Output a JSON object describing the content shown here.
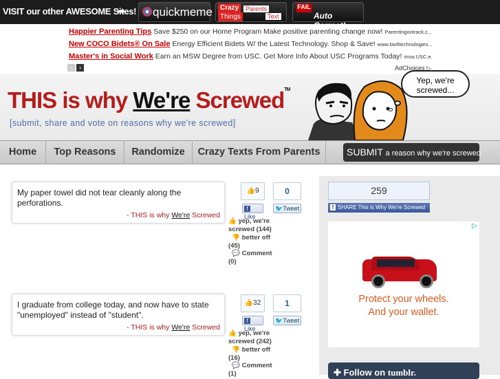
{
  "topbar": {
    "visit_label": "VISIT our other AWESOME Sites!",
    "arrow": "➡",
    "sites": {
      "quickmeme": "quickmeme",
      "crazy_texts": {
        "crazy": "Crazy",
        "things": "Things",
        "parents": "Parents",
        "text": "Text"
      },
      "fail": {
        "fail": "FAIL",
        "auto": "Auto Correct!"
      }
    }
  },
  "ads": {
    "items": [
      {
        "title": "Happier Parenting Tips",
        "text": "Save $250 on our Home Program Make positive parenting change now!",
        "url": "Parentingontrack.c..."
      },
      {
        "title": "New COCO Bidets® On Sale",
        "text": "Energy Efficient Bidets W/ the Latest Technology. Shop & Save!",
        "url": "www.biofitechnologies..."
      },
      {
        "title": "Master's in Social Work",
        "text": "Earn an MSW Degree from USC. Get More Info About USC Programs Today!",
        "url": "msw.USC.e..."
      }
    ],
    "prev": "‹",
    "next": "›",
    "adchoices": "AdChoices ▷"
  },
  "header": {
    "logo_part1": "THIS is why ",
    "logo_part2": "We're",
    "logo_part3": " Screwed",
    "tm": "TM",
    "tagline": "[submit, share and vote on reasons why we're screwed]",
    "bubble": "Yep, we're screwed..."
  },
  "nav": {
    "home": "Home",
    "top": "Top Reasons",
    "random": "Randomize",
    "crazy": "Crazy Texts From Parents",
    "submit_main": "SUBMIT",
    "submit_small": "a reason why we're screwed"
  },
  "posts": [
    {
      "text": "My paper towel did not tear cleanly along the perforations.",
      "sign_prefix": "- THIS is why ",
      "sign_bold": "We're",
      "sign_suffix": " Screwed",
      "likes": "9",
      "count": "0",
      "like_label": "Like",
      "tweet_label": "Tweet",
      "yep": "yep, we're screwed (144)",
      "better": "better off (45)",
      "comment": "Comment (0)"
    },
    {
      "text": "I graduate from college today, and now have to state \"unemployed\" instead of \"student\".",
      "sign_prefix": "- THIS is why ",
      "sign_bold": "We're",
      "sign_suffix": " Screwed",
      "likes": "32",
      "count": "1",
      "like_label": "Like",
      "tweet_label": "Tweet",
      "yep": "yep, we're screwed (242)",
      "better": "better off (16)",
      "comment": "Comment (1)"
    }
  ],
  "sidebar": {
    "share_count": "259",
    "share_label": "SHARE This is Why We're Screwed",
    "ad_line1": "Protect your wheels.",
    "ad_line2": "And your wallet.",
    "tumblr_prefix": "Follow on ",
    "tumblr_brand": "tumblr."
  },
  "colors": {
    "brand_red": "#b51d1d",
    "tagline_blue": "#4a6ea8",
    "ad_orange": "#e35a1e",
    "facebook": "#3b5998"
  }
}
